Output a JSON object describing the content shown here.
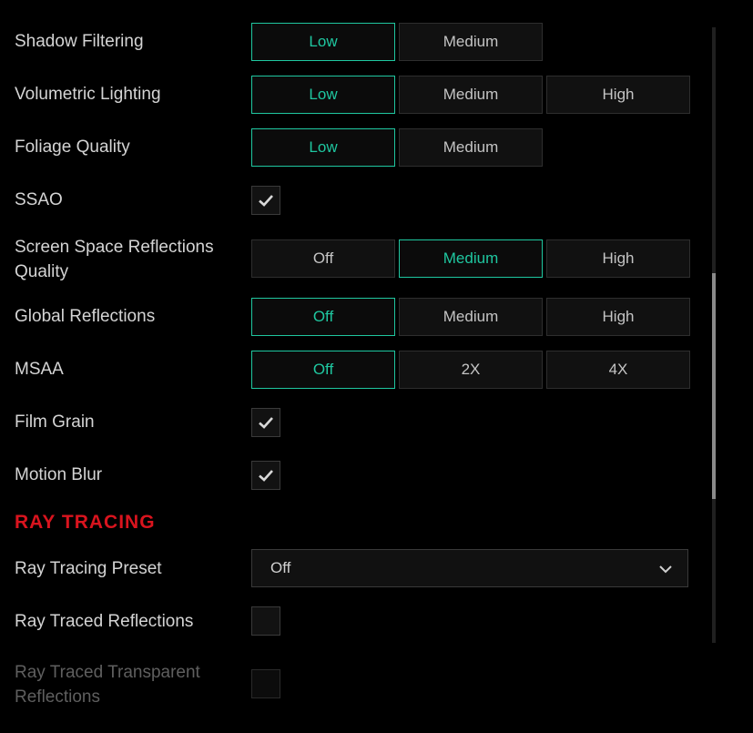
{
  "settings": {
    "shadow_filtering": {
      "label": "Shadow Filtering",
      "options": [
        "Low",
        "Medium"
      ],
      "selected": "Low"
    },
    "volumetric_lighting": {
      "label": "Volumetric Lighting",
      "options": [
        "Low",
        "Medium",
        "High"
      ],
      "selected": "Low"
    },
    "foliage_quality": {
      "label": "Foliage Quality",
      "options": [
        "Low",
        "Medium"
      ],
      "selected": "Low"
    },
    "ssao": {
      "label": "SSAO",
      "checked": true
    },
    "ssr_quality": {
      "label_line1": "Screen Space Reflections",
      "label_line2": "Quality",
      "options": [
        "Off",
        "Medium",
        "High"
      ],
      "selected": "Medium"
    },
    "global_reflections": {
      "label": "Global Reflections",
      "options": [
        "Off",
        "Medium",
        "High"
      ],
      "selected": "Off"
    },
    "msaa": {
      "label": "MSAA",
      "options": [
        "Off",
        "2X",
        "4X"
      ],
      "selected": "Off"
    },
    "film_grain": {
      "label": "Film Grain",
      "checked": true
    },
    "motion_blur": {
      "label": "Motion Blur",
      "checked": true
    }
  },
  "ray_tracing": {
    "section_title": "RAY TRACING",
    "preset": {
      "label": "Ray Tracing Preset",
      "value": "Off"
    },
    "reflections": {
      "label": "Ray Traced Reflections",
      "checked": false
    },
    "transparent_reflections": {
      "label_line1": "Ray Traced Transparent",
      "label_line2": "Reflections",
      "checked": false,
      "disabled": true
    }
  },
  "colors": {
    "accent": "#1fc7a0",
    "section_title": "#d9141e",
    "background": "#000000"
  },
  "icons": {
    "check": "check-icon",
    "dropdown": "chevron-down-icon"
  }
}
